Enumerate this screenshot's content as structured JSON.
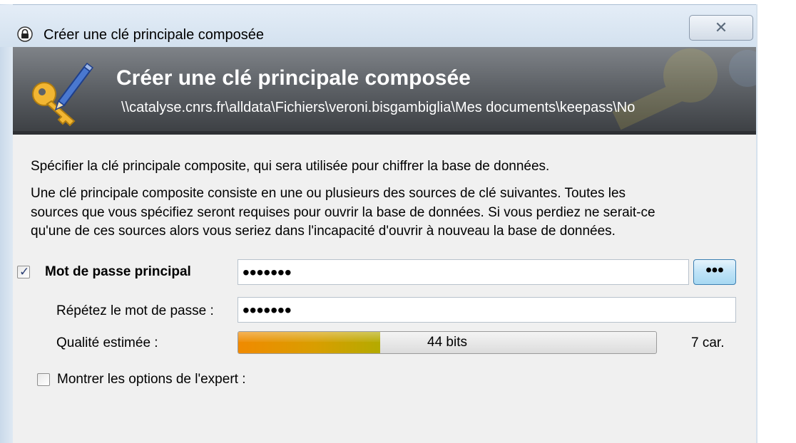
{
  "window": {
    "title": "Créer une clé principale composée",
    "close_glyph": "✕",
    "icon": "lock-icon"
  },
  "banner": {
    "title": "Créer une clé principale composée",
    "path": "\\\\catalyse.cnrs.fr\\alldata\\Fichiers\\veroni.bisgambiglia\\Mes documents\\keepass\\No",
    "icon": "key-pen-icon"
  },
  "intro": {
    "line1": "Spécifier la clé principale composite, qui sera utilisée pour chiffrer la base de données.",
    "para2_line1": "Une clé principale composite consiste en une ou plusieurs des sources de clé suivantes. Toutes les",
    "para2_line2": "sources que vous spécifiez seront requises pour ouvrir la base de données. Si vous perdiez ne serait-ce",
    "para2_line3": "qu'une de ces sources alors vous seriez dans l'incapacité d'ouvrir à nouveau la base de données."
  },
  "password": {
    "checkbox_checked": true,
    "checkmark": "✓",
    "label": "Mot de passe principal",
    "masked_value": "•••••••",
    "toggle_label": "•••",
    "repeat_label": "Répétez le mot de passe :",
    "repeat_masked_value": "•••••••"
  },
  "quality": {
    "label": "Qualité estimée :",
    "bar_text": "44 bits",
    "fill_fraction": 0.34,
    "length_text": "7 car."
  },
  "expert": {
    "checkbox_checked": false,
    "label": "Montrer les options de l'expert :"
  },
  "colors": {
    "banner_dark": "#3b3e42",
    "quality_orange": "#f08a00",
    "quality_olive": "#b4aa00",
    "dots_button_blue": "#a7d8f2"
  }
}
